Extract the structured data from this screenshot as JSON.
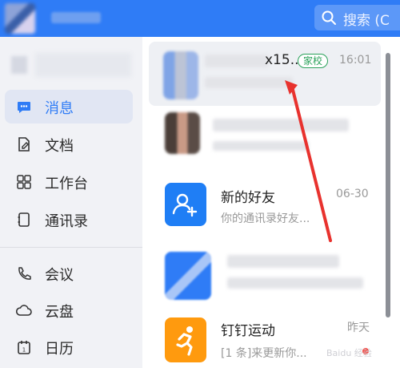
{
  "header": {
    "search_placeholder": "搜索 (C",
    "brand_color": "#2f7cf6"
  },
  "sidebar": {
    "items": [
      {
        "label": "消息",
        "icon": "message-icon",
        "active": true
      },
      {
        "label": "文档",
        "icon": "document-icon",
        "active": false
      },
      {
        "label": "工作台",
        "icon": "apps-grid-icon",
        "active": false
      },
      {
        "label": "通讯录",
        "icon": "contacts-icon",
        "active": false
      },
      {
        "label": "会议",
        "icon": "phone-icon",
        "active": false
      },
      {
        "label": "云盘",
        "icon": "cloud-icon",
        "active": false
      },
      {
        "label": "日历",
        "icon": "calendar-icon",
        "active": false
      }
    ]
  },
  "conversations": [
    {
      "title_suffix": "x15...",
      "tag": "家校",
      "time": "16:01",
      "preview": "",
      "selected": true,
      "icon": "blurred-avatar"
    },
    {
      "title_suffix": "",
      "tag": "",
      "time": "",
      "preview": "",
      "selected": false,
      "icon": "blurred-photo"
    },
    {
      "title": "新的好友",
      "time": "06-30",
      "preview": "你的通讯录好友...",
      "icon": "add-friend-icon",
      "color": "#1f7ef5"
    },
    {
      "title_suffix": "",
      "time": "",
      "preview": "",
      "icon": "blurred-avatar"
    },
    {
      "title": "钉钉运动",
      "time": "昨天",
      "preview": "[1 条]来更新你...",
      "icon": "running-icon",
      "color": "#ff9a0e"
    }
  ],
  "watermark": "Baidu 经验"
}
